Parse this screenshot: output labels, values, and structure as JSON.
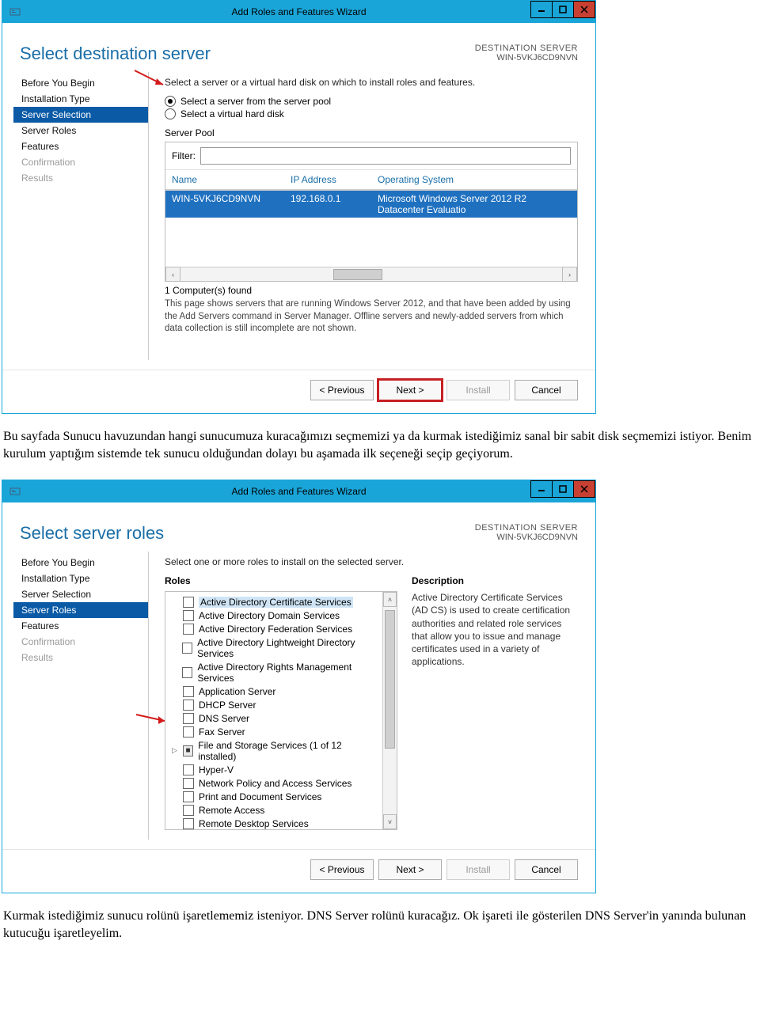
{
  "window1": {
    "title": "Add Roles and Features Wizard",
    "page_title": "Select destination server",
    "dest_label": "DESTINATION SERVER",
    "dest_value": "WIN-5VKJ6CD9NVN",
    "nav": {
      "before": "Before You Begin",
      "inst_type": "Installation Type",
      "server_sel": "Server Selection",
      "server_roles": "Server Roles",
      "features": "Features",
      "confirm": "Confirmation",
      "results": "Results"
    },
    "intro": "Select a server or a virtual hard disk on which to install roles and features.",
    "radio_pool": "Select a server from the server pool",
    "radio_vhd": "Select a virtual hard disk",
    "pool_label": "Server Pool",
    "filter_label": "Filter:",
    "filter_value": "",
    "columns": {
      "name": "Name",
      "ip": "IP Address",
      "os": "Operating System"
    },
    "row": {
      "name": "WIN-5VKJ6CD9NVN",
      "ip": "192.168.0.1",
      "os": "Microsoft Windows Server 2012 R2 Datacenter Evaluatio"
    },
    "found": "1 Computer(s) found",
    "help": "This page shows servers that are running Windows Server 2012, and that have been added by using the Add Servers command in Server Manager. Offline servers and newly-added servers from which data collection is still incomplete are not shown.",
    "buttons": {
      "prev": "< Previous",
      "next": "Next >",
      "install": "Install",
      "cancel": "Cancel"
    }
  },
  "para1": "Bu sayfada Sunucu havuzundan hangi sunucumuza kuracağımızı seçmemizi ya da kurmak istediğimiz sanal bir sabit disk seçmemizi istiyor. Benim kurulum yaptığım sistemde tek sunucu olduğundan dolayı bu aşamada ilk seçeneği seçip geçiyorum.",
  "window2": {
    "title": "Add Roles and Features Wizard",
    "page_title": "Select server roles",
    "dest_label": "DESTINATION SERVER",
    "dest_value": "WIN-5VKJ6CD9NVN",
    "nav": {
      "before": "Before You Begin",
      "inst_type": "Installation Type",
      "server_sel": "Server Selection",
      "server_roles": "Server Roles",
      "features": "Features",
      "confirm": "Confirmation",
      "results": "Results"
    },
    "intro": "Select one or more roles to install on the selected server.",
    "roles_head": "Roles",
    "desc_head": "Description",
    "desc_text": "Active Directory Certificate Services (AD CS) is used to create certification authorities and related role services that allow you to issue and manage certificates used in a variety of applications.",
    "roles": {
      "r0": "Active Directory Certificate Services",
      "r1": "Active Directory Domain Services",
      "r2": "Active Directory Federation Services",
      "r3": "Active Directory Lightweight Directory Services",
      "r4": "Active Directory Rights Management Services",
      "r5": "Application Server",
      "r6": "DHCP Server",
      "r7": "DNS Server",
      "r8": "Fax Server",
      "r9": "File and Storage Services (1 of 12 installed)",
      "r10": "Hyper-V",
      "r11": "Network Policy and Access Services",
      "r12": "Print and Document Services",
      "r13": "Remote Access",
      "r14": "Remote Desktop Services"
    },
    "buttons": {
      "prev": "< Previous",
      "next": "Next >",
      "install": "Install",
      "cancel": "Cancel"
    }
  },
  "para2": "Kurmak istediğimiz sunucu rolünü işaretlememiz isteniyor. DNS Server rolünü kuracağız. Ok işareti ile gösterilen DNS Server'in yanında bulunan kutucuğu işaretleyelim."
}
